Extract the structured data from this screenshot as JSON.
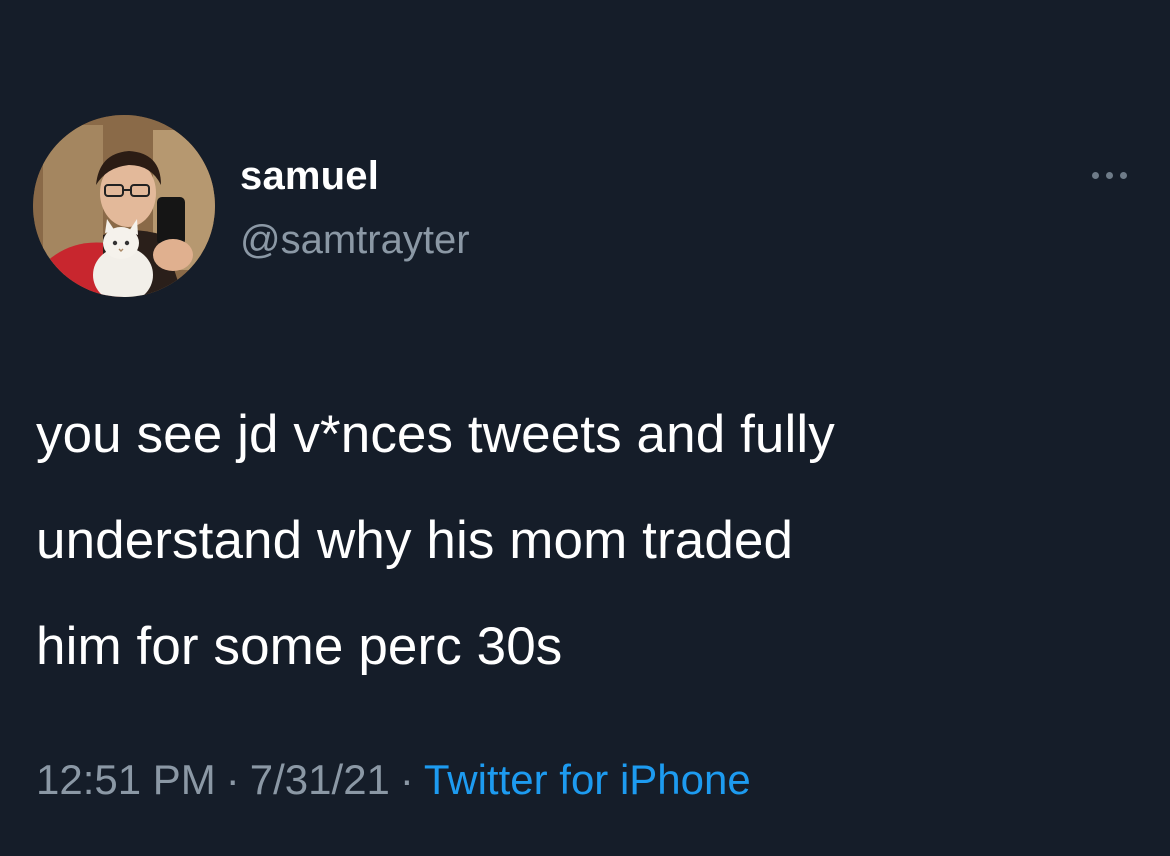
{
  "author": {
    "display_name": "samuel",
    "handle": "@samtrayter",
    "avatar_icon": "profile-photo"
  },
  "more_icon": "ellipsis-icon",
  "tweet": {
    "text": "you see jd v*nces tweets and fully\nunderstand why his mom traded\nhim for some perc 30s"
  },
  "meta": {
    "time": "12:51 PM",
    "separator": "·",
    "date": "7/31/21",
    "source": "Twitter for iPhone"
  },
  "colors": {
    "background": "#151d29",
    "text_primary": "#ffffff",
    "text_secondary": "#8b98a5",
    "accent": "#1d9bf0"
  }
}
